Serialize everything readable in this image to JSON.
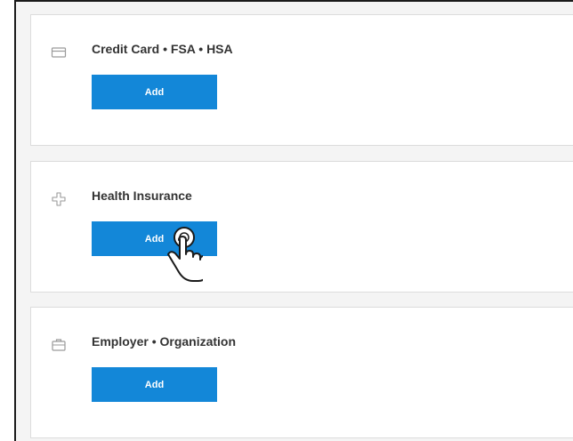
{
  "cards": [
    {
      "title": "Credit Card • FSA • HSA",
      "icon": "credit-card-icon",
      "button_label": "Add"
    },
    {
      "title": "Health Insurance",
      "icon": "medical-cross-icon",
      "button_label": "Add"
    },
    {
      "title": "Employer • Organization",
      "icon": "briefcase-icon",
      "button_label": "Add"
    }
  ],
  "colors": {
    "button": "#1387d8",
    "background": "#f4f4f4",
    "card": "#ffffff",
    "text": "#333333"
  },
  "cursor": "hand-pointer-icon"
}
